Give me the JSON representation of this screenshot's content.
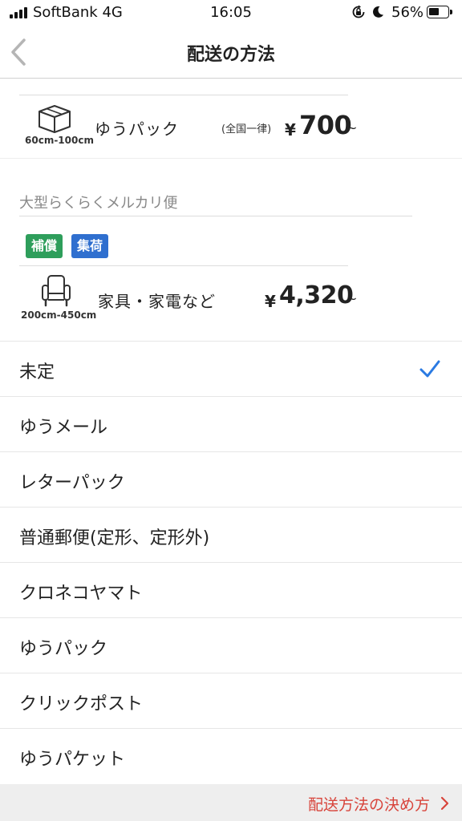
{
  "status_bar": {
    "carrier": "SoftBank 4G",
    "time": "16:05",
    "battery_percent": "56%",
    "battery_level": 0.56,
    "icons": [
      "signal-icon",
      "orientation-lock-icon",
      "moon-icon",
      "battery-icon"
    ]
  },
  "nav": {
    "title": "配送の方法",
    "back_icon": "chevron-left-icon"
  },
  "yupack_card": {
    "icon": "box-icon",
    "size": "60cm-100cm",
    "name": "ゆうパック",
    "note": "(全国一律)",
    "yen": "¥",
    "price": "700",
    "tilde": "~"
  },
  "large_section": {
    "heading": "大型らくらくメルカリ便",
    "badges": [
      {
        "label": "補償",
        "color": "#2e9e5b"
      },
      {
        "label": "集荷",
        "color": "#2f6fcf"
      }
    ],
    "card": {
      "icon": "armchair-icon",
      "size": "200cm-450cm",
      "name": "家具・家電など",
      "yen": "¥",
      "price": "4,320",
      "tilde": "~"
    }
  },
  "options": [
    {
      "label": "未定",
      "selected": true
    },
    {
      "label": "ゆうメール",
      "selected": false
    },
    {
      "label": "レターパック",
      "selected": false
    },
    {
      "label": "普通郵便(定形、定形外)",
      "selected": false
    },
    {
      "label": "クロネコヤマト",
      "selected": false
    },
    {
      "label": "ゆうパック",
      "selected": false
    },
    {
      "label": "クリックポスト",
      "selected": false
    },
    {
      "label": "ゆうパケット",
      "selected": false
    }
  ],
  "footer": {
    "link_label": "配送方法の決め方",
    "chevron_icon": "chevron-right-icon"
  },
  "colors": {
    "accent_blue": "#2a7ae2",
    "link_red": "#d8443b"
  }
}
